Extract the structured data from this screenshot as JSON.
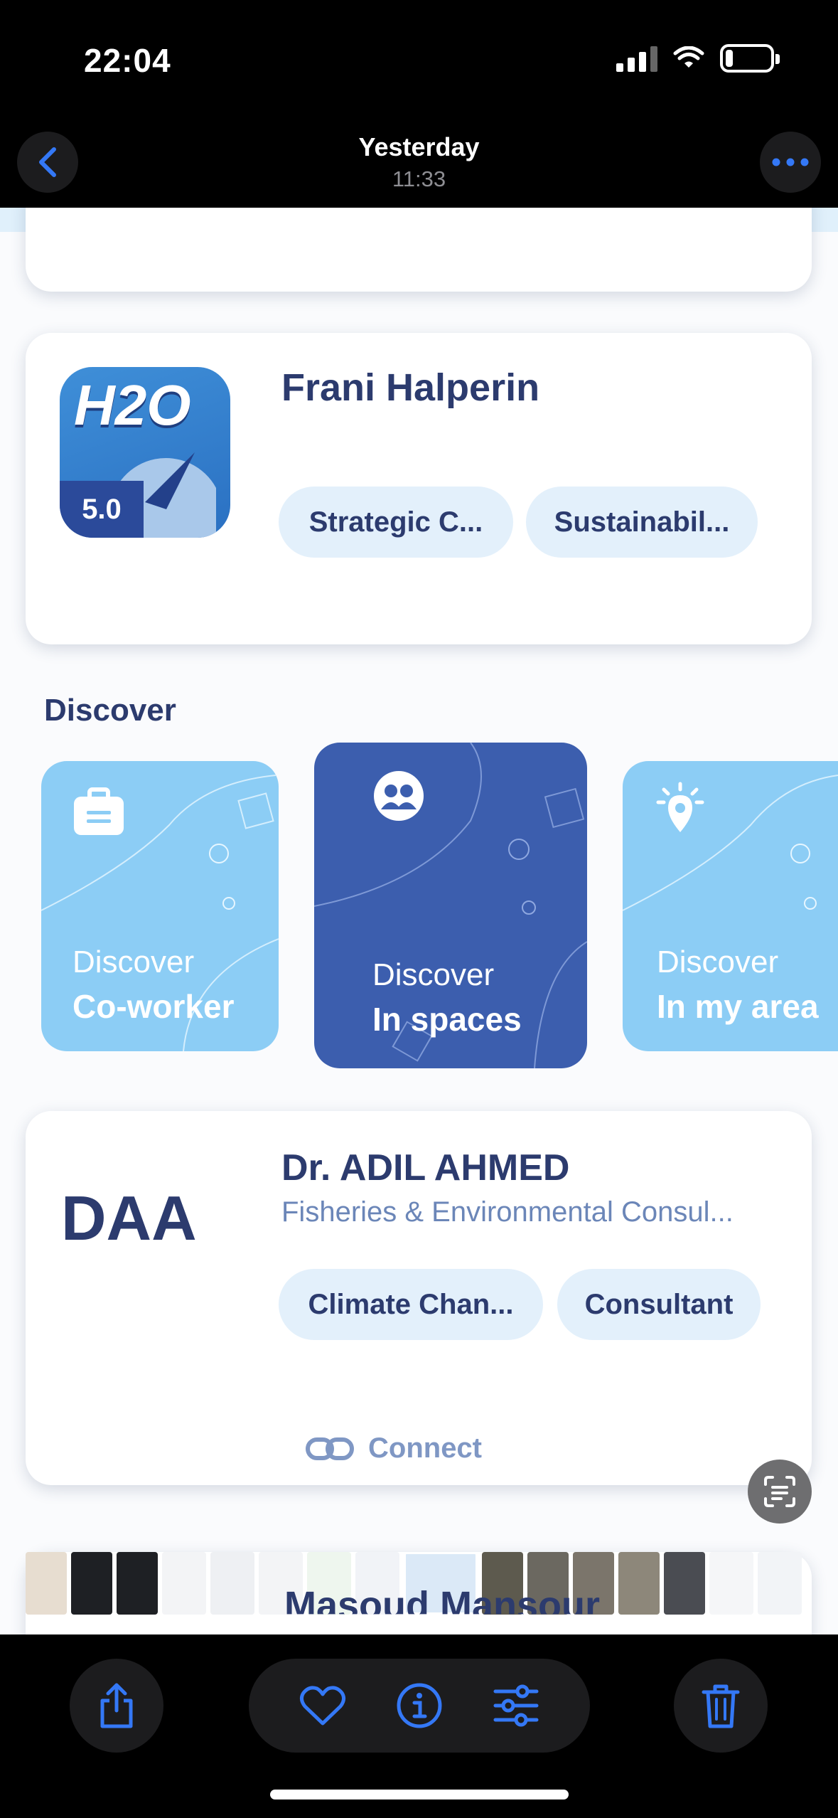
{
  "status_bar": {
    "time": "22:04",
    "battery_level": 0.15
  },
  "nav": {
    "title": "Yesterday",
    "subtitle": "11:33"
  },
  "frani_card": {
    "name": "Frani Halperin",
    "app_icon": {
      "brand": "H2O",
      "rating": "5.0"
    },
    "chips": [
      "Strategic C...",
      "Sustainabil..."
    ]
  },
  "discover": {
    "title": "Discover",
    "cards": [
      {
        "line1": "Discover",
        "line2": "Co-worker",
        "icon": "briefcase-icon"
      },
      {
        "line1": "Discover",
        "line2": "In spaces",
        "icon": "group-icon"
      },
      {
        "line1": "Discover",
        "line2": "In my area",
        "icon": "location-pin-icon"
      }
    ]
  },
  "adil_card": {
    "initials": "DAA",
    "name": "Dr. ADIL AHMED",
    "title": "Fisheries & Environmental Consul...",
    "chips": [
      "Climate Chan...",
      "Consultant"
    ],
    "connect_label": "Connect"
  },
  "behind_text": "Masoud Mansour",
  "colors": {
    "accent": "#3478f6",
    "navy": "#2c3b6e",
    "light_blue": "#8ccdf5",
    "dark_blue": "#3c5eae",
    "chip_bg": "#e3f0fb"
  },
  "toolbar": {
    "icons": [
      "share-icon",
      "heart-icon",
      "info-icon",
      "adjust-icon",
      "trash-icon"
    ]
  }
}
